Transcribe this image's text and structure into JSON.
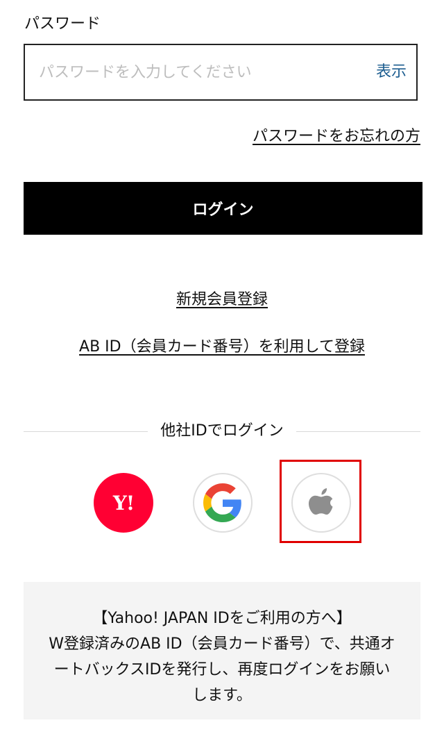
{
  "password": {
    "label": "パスワード",
    "placeholder": "パスワードを入力してください",
    "value": "",
    "toggle_label": "表示"
  },
  "forgot_link": "パスワードをお忘れの方",
  "login_button": "ログイン",
  "register_link": "新規会員登録",
  "abid_register_link": "AB ID（会員カード番号）を利用して登録",
  "social": {
    "heading": "他社IDでログイン",
    "providers": [
      {
        "name": "Yahoo! JAPAN",
        "icon": "yahoo-logo-icon",
        "mark": "Y!",
        "color": "#ff0033"
      },
      {
        "name": "Google",
        "icon": "google-logo-icon"
      },
      {
        "name": "Apple",
        "icon": "apple-logo-icon",
        "color": "#8e8e8e"
      }
    ],
    "highlight_color": "#e00000"
  },
  "notice": {
    "lines": [
      "【Yahoo! JAPAN IDをご利用の方へ】",
      "W登録済みのAB ID（会員カード番号）で、共通オ",
      "ートバックスIDを発行し、再度ログインをお願い",
      "します。"
    ]
  },
  "colors": {
    "primary_button": "#000000",
    "link_accent": "#1b5c8f",
    "notice_background": "#f4f4f4"
  }
}
